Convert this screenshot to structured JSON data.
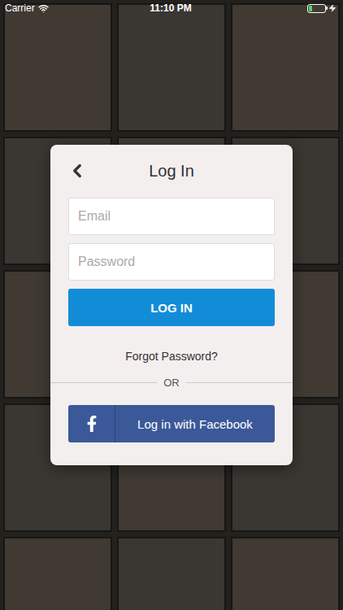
{
  "status_bar": {
    "carrier": "Carrier",
    "time": "11:10 PM",
    "battery": {
      "level": 0.22,
      "charging": true
    }
  },
  "dialog": {
    "title": "Log In",
    "fields": [
      {
        "placeholder": "Email"
      },
      {
        "placeholder": "Password"
      }
    ],
    "login_button": "LOG IN",
    "forgot_link": "Forgot Password?",
    "divider": "OR",
    "facebook_button": "Log in with Facebook"
  }
}
